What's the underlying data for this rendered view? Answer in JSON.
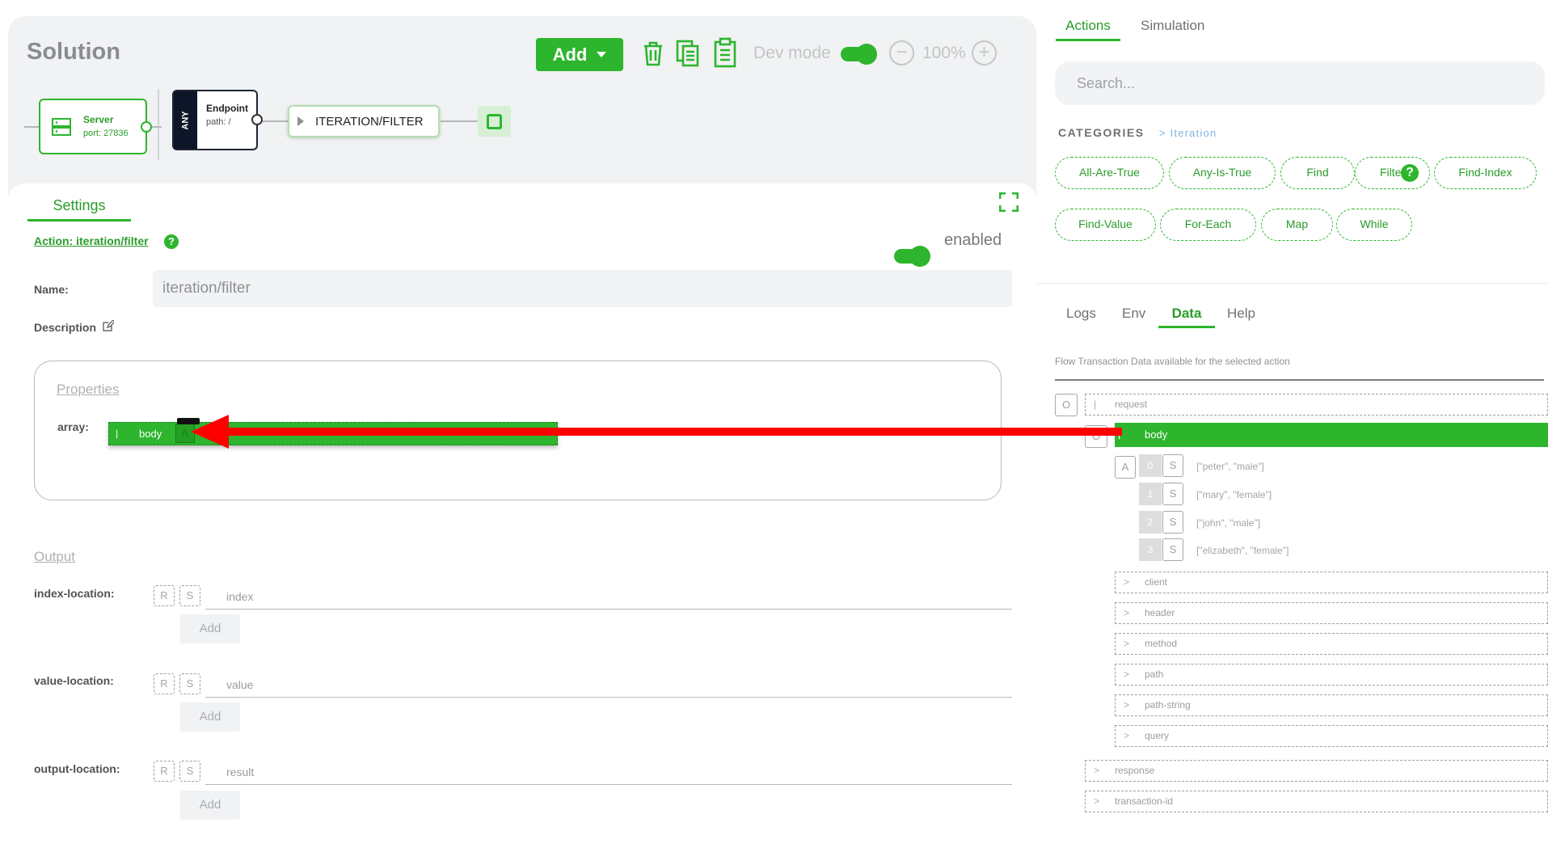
{
  "solution": {
    "title": "Solution",
    "add_label": "Add",
    "dev_mode_label": "Dev mode",
    "zoom_label": "100%",
    "zoom_out_symbol": "−",
    "zoom_in_symbol": "+",
    "toolbar_icons": [
      "trash-icon",
      "copy-icon",
      "paste-icon"
    ]
  },
  "flow": {
    "server": {
      "title": "Server",
      "port": "port: 27836"
    },
    "endpoint": {
      "method": "ANY",
      "title": "Endpoint",
      "path": "path: /"
    },
    "action_node": "ITERATION/FILTER"
  },
  "settings": {
    "tab": "Settings",
    "action_link": "Action: iteration/filter",
    "enabled_label": "enabled",
    "name_label": "Name:",
    "name_value": "iteration/filter",
    "description_label": "Description",
    "properties_title": "Properties",
    "array_label": "array:",
    "array_value_marker": "|",
    "array_value": "body",
    "array_badge": "A",
    "output_title": "Output",
    "outputs": [
      {
        "label": "index-location:",
        "r": "R",
        "s": "S",
        "value": "index",
        "add": "Add"
      },
      {
        "label": "value-location:",
        "r": "R",
        "s": "S",
        "value": "value",
        "add": "Add"
      },
      {
        "label": "output-location:",
        "r": "R",
        "s": "S",
        "value": "result",
        "add": "Add"
      }
    ]
  },
  "right_panel": {
    "tabs": [
      "Actions",
      "Simulation"
    ],
    "active_tab": "Actions",
    "search_placeholder": "Search...",
    "categories_label": "CATEGORIES",
    "breadcrumb": "> Iteration",
    "categories": [
      "All-Are-True",
      "Any-Is-True",
      "Find",
      "Filter",
      "Find-Index",
      "Find-Value",
      "For-Each",
      "Map",
      "While"
    ],
    "bottom_tabs": [
      "Logs",
      "Env",
      "Data",
      "Help"
    ],
    "active_bottom_tab": "Data",
    "data_caption": "Flow Transaction Data available for the selected action",
    "tree": {
      "request": {
        "badge": "O",
        "marker": "|",
        "label": "request"
      },
      "body": {
        "badge": "O",
        "marker": "|",
        "label": "body"
      },
      "array_badge": "A",
      "items": [
        {
          "index": "0",
          "type": "S",
          "value": "[\"peter\", \"male\"]"
        },
        {
          "index": "1",
          "type": "S",
          "value": "[\"mary\", \"female\"]"
        },
        {
          "index": "2",
          "type": "S",
          "value": "[\"john\", \"male\"]"
        },
        {
          "index": "3",
          "type": "S",
          "value": "[\"elizabeth\", \"female\"]"
        }
      ],
      "request_children": [
        "client",
        "header",
        "method",
        "path",
        "path-string",
        "query"
      ],
      "roots": [
        "response",
        "transaction-id"
      ],
      "collapsed_chevron": ">"
    }
  },
  "colors": {
    "accent": "#2db52d",
    "arrow": "#ff0000",
    "dark_node": "#0d1628"
  }
}
